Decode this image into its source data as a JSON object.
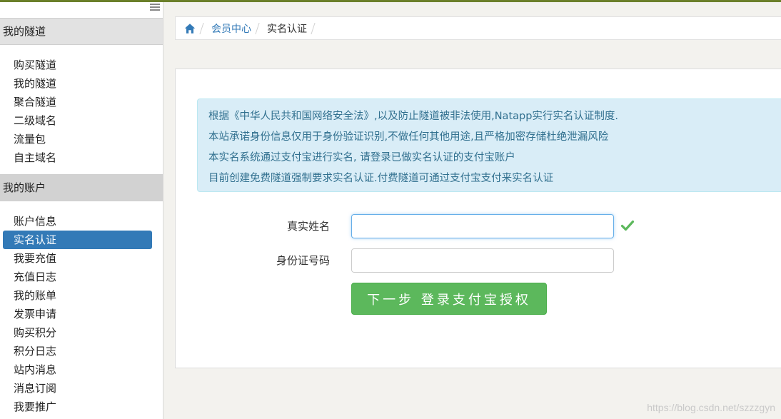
{
  "colors": {
    "accent": "#337ab7",
    "success": "#5cb85c",
    "alert_bg": "#d9edf7",
    "alert_text": "#31708f",
    "check": "#5cb85c"
  },
  "sidebar": {
    "sections": [
      {
        "title": "我的隧道",
        "items": [
          "购买隧道",
          "我的隧道",
          "聚合隧道",
          "二级域名",
          "流量包",
          "自主域名"
        ]
      },
      {
        "title": "我的账户",
        "items": [
          "账户信息",
          "实名认证",
          "我要充值",
          "充值日志",
          "我的账单",
          "发票申请",
          "购买积分",
          "积分日志",
          "站内消息",
          "消息订阅",
          "我要推广"
        ]
      }
    ],
    "active_item": "实名认证",
    "toggle_icon": "menu-icon"
  },
  "breadcrumb": {
    "home_icon": "home-icon",
    "link": "会员中心",
    "current": "实名认证"
  },
  "notice": {
    "lines": [
      "根据《中华人民共和国网络安全法》,以及防止隧道被非法使用,Natapp实行实名认证制度.",
      "本站承诺身份信息仅用于身份验证识别,不做任何其他用途,且严格加密存储杜绝泄漏风险",
      "本实名系统通过支付宝进行实名, 请登录已做实名认证的支付宝账户",
      "目前创建免费隧道强制要求实名认证.付费隧道可通过支付宝支付来实名认证"
    ]
  },
  "form": {
    "name_label": "真实姓名",
    "name_value": "",
    "name_status_icon": "check-icon",
    "id_label": "身份证号码",
    "id_value": "",
    "submit_label": "下一步 登录支付宝授权"
  },
  "watermark": "https://blog.csdn.net/szzzgyn"
}
